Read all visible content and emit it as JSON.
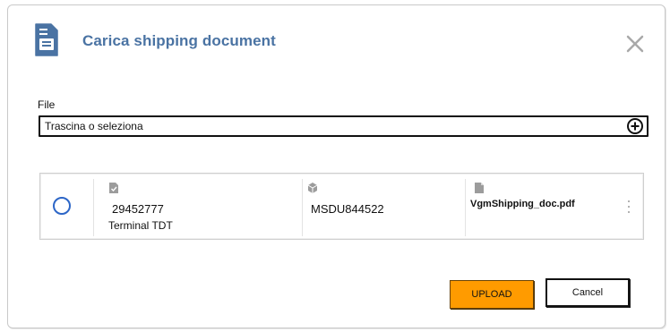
{
  "dialog": {
    "title": "Carica shipping document",
    "title_icon": "document-icon",
    "close_icon": "close-icon"
  },
  "file": {
    "label": "File",
    "placeholder": "Trascina o seleziona",
    "add_icon": "plus-circle-icon"
  },
  "record": {
    "selected": false,
    "booking": {
      "icon": "document-check-icon",
      "number": "29452777",
      "terminal": "Terminal TDT"
    },
    "container": {
      "icon": "box-icon",
      "code": "MSDU844522"
    },
    "document": {
      "icon": "file-icon",
      "filename": "VgmShipping_doc.pdf"
    },
    "menu_icon": "more-vertical-icon"
  },
  "actions": {
    "upload_label": "UPLOAD",
    "cancel_label": "Cancel"
  },
  "colors": {
    "title": "#4a73a3",
    "upload_bg": "#ff9b00",
    "radio": "#2d66c7"
  }
}
